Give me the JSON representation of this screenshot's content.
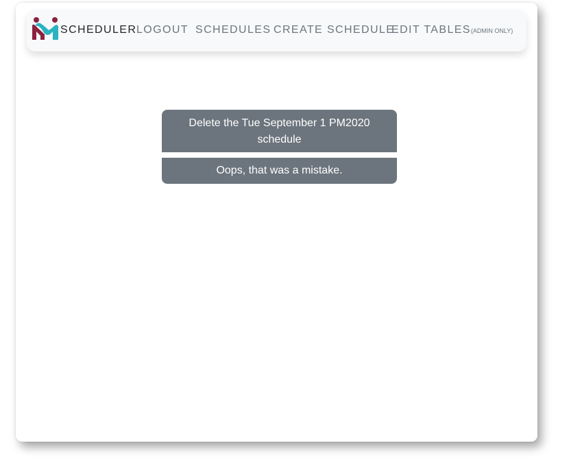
{
  "navbar": {
    "brand": "SCHEDULER",
    "links": [
      {
        "label": "LOGOUT"
      },
      {
        "label": "SCHEDULES"
      },
      {
        "label": "CREATE SCHEDULE"
      },
      {
        "label": "EDIT TABLES",
        "note": "(ADMIN ONLY)"
      }
    ]
  },
  "dialog": {
    "delete_label": "Delete the Tue September 1 PM2020 schedule",
    "cancel_label": "Oops, that was a mistake."
  },
  "colors": {
    "button_bg": "#6c757d",
    "navbar_bg": "#f8f9fa",
    "logo_maroon": "#8b2240",
    "logo_teal": "#2bb3bf"
  }
}
